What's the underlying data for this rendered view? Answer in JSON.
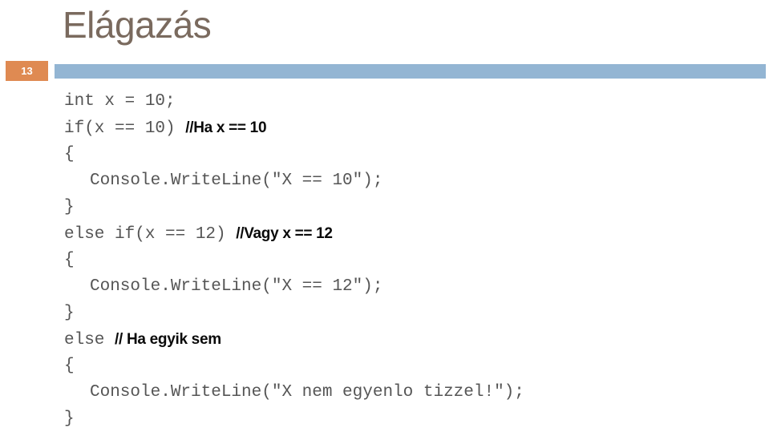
{
  "slide": {
    "title": "Elágazás",
    "number": "13",
    "accent_orange": "#df8a52",
    "accent_blue": "#93b5d3",
    "title_color": "#7a6a5e",
    "code_color": "#555555",
    "comment_color": "#0a0a0a"
  },
  "code": {
    "lines": [
      {
        "indent": 0,
        "code": "int x = 10;",
        "comment": ""
      },
      {
        "indent": 0,
        "code": "if(x == 10) ",
        "comment": "//Ha x == 10"
      },
      {
        "indent": 0,
        "code": "{",
        "comment": ""
      },
      {
        "indent": 1,
        "code": "Console.WriteLine(\"X == 10\");",
        "comment": ""
      },
      {
        "indent": 0,
        "code": "}",
        "comment": ""
      },
      {
        "indent": 0,
        "code": "else if(x == 12) ",
        "comment": "//Vagy x == 12"
      },
      {
        "indent": 0,
        "code": "{",
        "comment": ""
      },
      {
        "indent": 1,
        "code": "Console.WriteLine(\"X == 12\");",
        "comment": ""
      },
      {
        "indent": 0,
        "code": "}",
        "comment": ""
      },
      {
        "indent": 0,
        "code": "else ",
        "comment": "// Ha egyik sem"
      },
      {
        "indent": 0,
        "code": "{",
        "comment": ""
      },
      {
        "indent": 1,
        "code": "Console.WriteLine(\"X nem egyenlo tizzel!\");",
        "comment": ""
      },
      {
        "indent": 0,
        "code": "}",
        "comment": ""
      }
    ]
  }
}
